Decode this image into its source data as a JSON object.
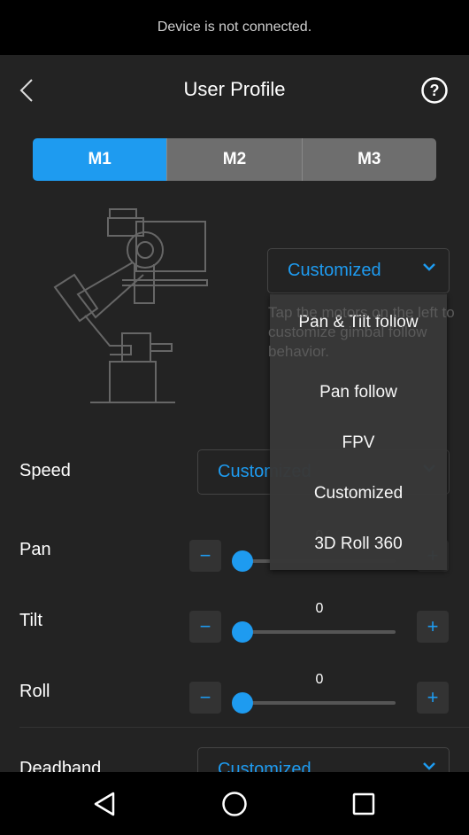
{
  "status_bar": {
    "message": "Device is not connected."
  },
  "header": {
    "title": "User Profile",
    "back_icon": "chevron-left-icon",
    "help_icon": "question-circle-icon"
  },
  "profiles": {
    "tabs": [
      {
        "label": "M1",
        "active": true
      },
      {
        "label": "M2",
        "active": false
      },
      {
        "label": "M3",
        "active": false
      }
    ]
  },
  "follow_mode": {
    "selected": "Customized",
    "help_text": "Tap the motors on the left to customize gimbal follow behavior.",
    "options": [
      "Pan & Tilt follow",
      "Pan follow",
      "FPV",
      "Customized",
      "3D Roll 360"
    ]
  },
  "speed": {
    "label": "Speed",
    "selected": "Customized"
  },
  "sliders": [
    {
      "label": "Pan",
      "value": "0"
    },
    {
      "label": "Tilt",
      "value": "0"
    },
    {
      "label": "Roll",
      "value": "0"
    }
  ],
  "deadband": {
    "label": "Deadband",
    "selected": "Customized"
  },
  "colors": {
    "accent": "#1e9bf0",
    "background": "#232323"
  }
}
